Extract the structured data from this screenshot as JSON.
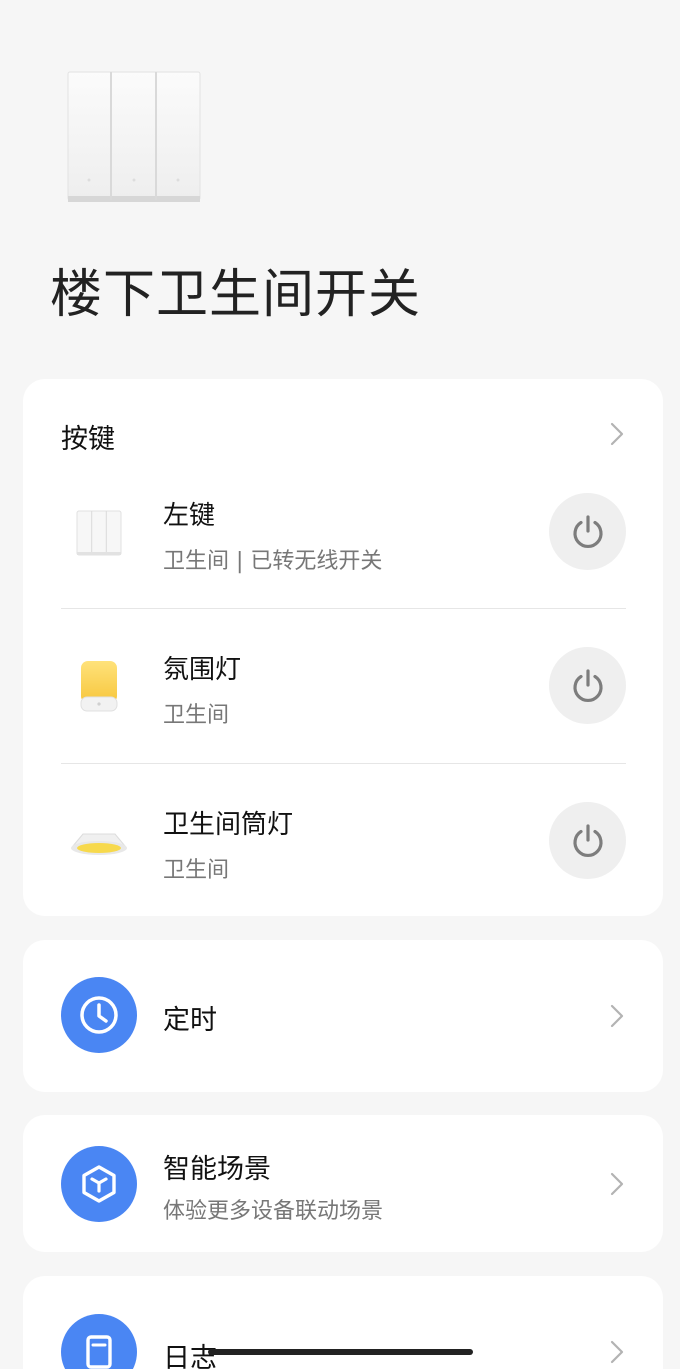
{
  "device": {
    "title": "楼下卫生间开关",
    "image": "three-gang-wall-switch"
  },
  "keys_section": {
    "heading": "按键",
    "items": [
      {
        "name": "左键",
        "subtitle": "卫生间 | 已转无线开关",
        "icon": "wall-switch-thumb"
      },
      {
        "name": "氛围灯",
        "subtitle": "卫生间",
        "icon": "ambient-lamp-thumb"
      },
      {
        "name": "卫生间筒灯",
        "subtitle": "卫生间",
        "icon": "downlight-thumb"
      }
    ]
  },
  "timer": {
    "label": "定时",
    "icon": "clock-icon"
  },
  "scene": {
    "label": "智能场景",
    "subtitle": "体验更多设备联动场景",
    "icon": "scene-cube-icon"
  },
  "log": {
    "label": "日志",
    "icon": "log-icon"
  },
  "colors": {
    "background": "#f6f6f6",
    "card": "#ffffff",
    "accent": "#4a86f3",
    "power_button": "#efefef",
    "secondary_text": "#777777"
  }
}
